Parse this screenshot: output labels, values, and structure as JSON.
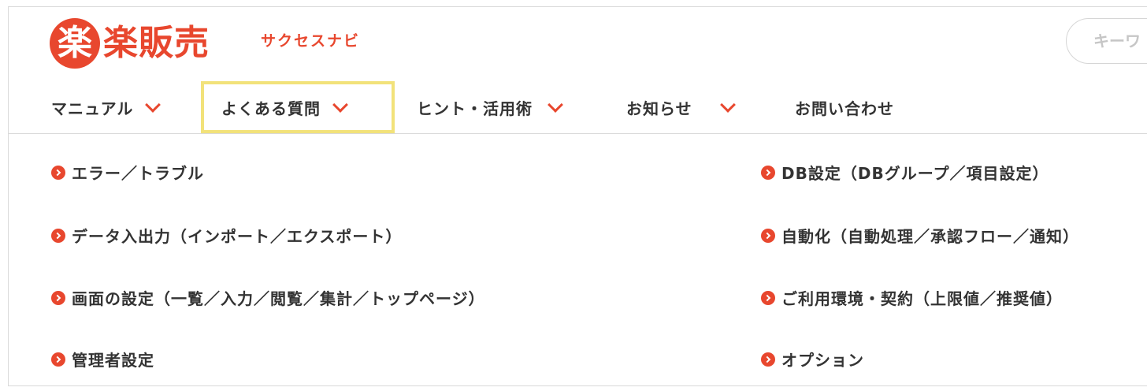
{
  "header": {
    "logo_mark": "楽",
    "logo_text": "楽販売",
    "logo_sub": "サクセスナビ",
    "search_placeholder": "キーワ"
  },
  "nav": {
    "items": [
      {
        "label": "マニュアル",
        "has_dropdown": true
      },
      {
        "label": "よくある質問",
        "has_dropdown": true,
        "active": true
      },
      {
        "label": "ヒント・活用術",
        "has_dropdown": true
      },
      {
        "label": "お知らせ",
        "has_dropdown": true
      },
      {
        "label": "お問い合わせ",
        "has_dropdown": false
      }
    ]
  },
  "menu": {
    "left": [
      {
        "label": "エラー／トラブル"
      },
      {
        "label": "データ入出力（インポート／エクスポート）"
      },
      {
        "label": "画面の設定（一覧／入力／閲覧／集計／トップページ）"
      },
      {
        "label": "管理者設定"
      }
    ],
    "right": [
      {
        "label": "DB設定（DBグループ／項目設定）"
      },
      {
        "label": "自動化（自動処理／承認フロー／通知）"
      },
      {
        "label": "ご利用環境・契約（上限値／推奨値）"
      },
      {
        "label": "オプション"
      }
    ]
  },
  "colors": {
    "accent": "#e8472e",
    "highlight": "#f2e27a",
    "text": "#333333"
  }
}
